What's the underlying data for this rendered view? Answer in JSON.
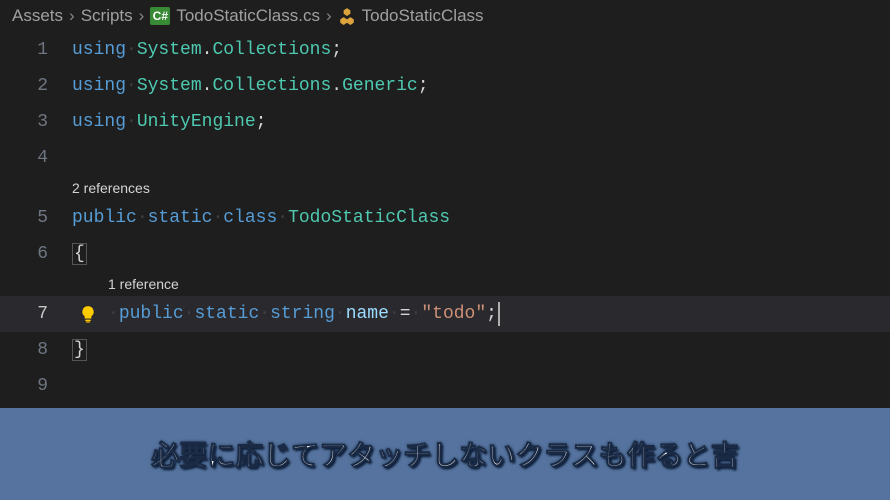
{
  "breadcrumbs": {
    "seg1": "Assets",
    "seg2": "Scripts",
    "seg3": "TodoStaticClass.cs",
    "seg4": "TodoStaticClass",
    "cs_badge": "C#"
  },
  "gutter": {
    "l1": "1",
    "l2": "2",
    "l3": "3",
    "l4": "4",
    "l5": "5",
    "l6": "6",
    "l7": "7",
    "l8": "8",
    "l9": "9"
  },
  "codelens": {
    "class_refs": "2 references",
    "field_refs": "1 reference"
  },
  "code": {
    "using": "using",
    "dot": ".",
    "semi": ";",
    "ns_system": "System",
    "ns_collections": "Collections",
    "ns_generic": "Generic",
    "ns_unity": "UnityEngine",
    "public": "public",
    "static": "static",
    "class": "class",
    "classname": "TodoStaticClass",
    "lbrace": "{",
    "rbrace": "}",
    "string": "string",
    "fieldname": "name",
    "equals": "=",
    "strval": "\"todo\""
  },
  "caption": "必要に応じてアタッチしないクラスも作ると吉"
}
